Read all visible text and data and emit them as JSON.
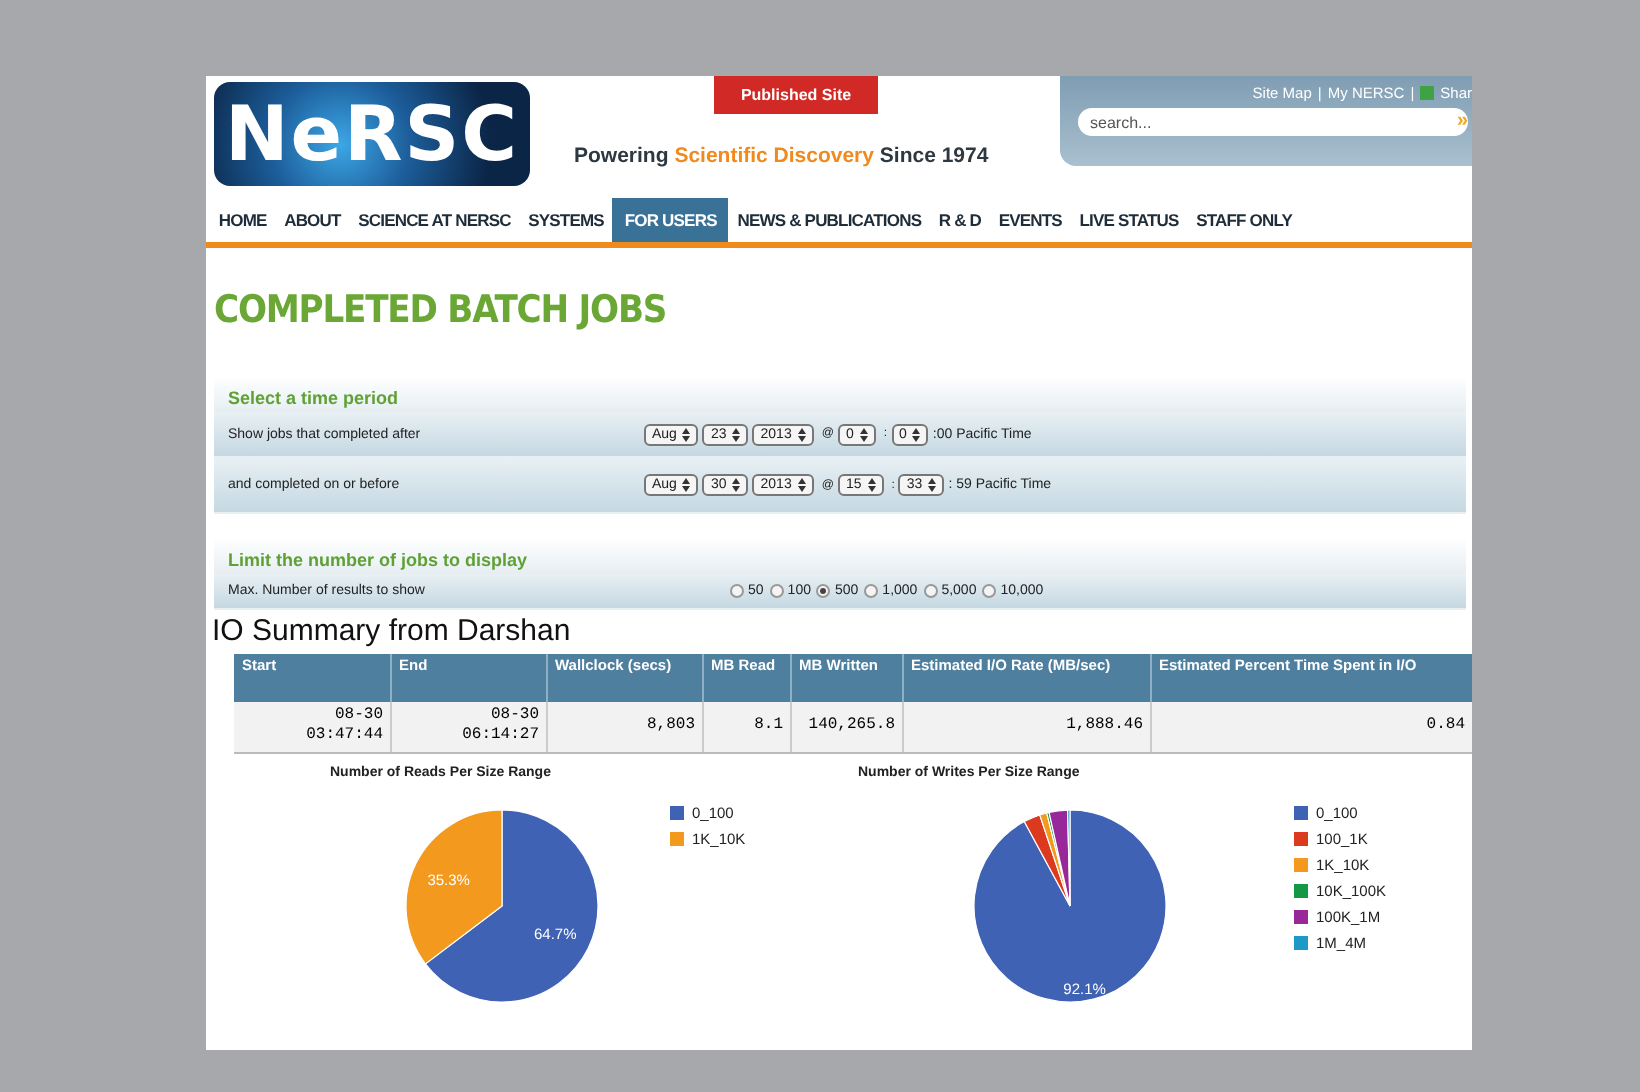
{
  "header": {
    "logo": "NeRSC",
    "published_tab": "Published Site",
    "tagline": {
      "before": "Powering",
      "highlight": "Scientific Discovery",
      "after": "Since 1974"
    },
    "top_links": [
      "Site Map",
      "My NERSC",
      "Shar"
    ],
    "link_separator": "|",
    "search": {
      "placeholder": "search...",
      "button": "»"
    }
  },
  "nav": [
    {
      "label": "HOME",
      "selected": false
    },
    {
      "label": "ABOUT",
      "selected": false
    },
    {
      "label": "SCIENCE AT NERSC",
      "selected": false
    },
    {
      "label": "SYSTEMS",
      "selected": false
    },
    {
      "label": "FOR USERS",
      "selected": true
    },
    {
      "label": "NEWS & PUBLICATIONS",
      "selected": false
    },
    {
      "label": "R & D",
      "selected": false
    },
    {
      "label": "EVENTS",
      "selected": false
    },
    {
      "label": "LIVE STATUS",
      "selected": false
    },
    {
      "label": "STAFF ONLY",
      "selected": false
    }
  ],
  "page_title": "COMPLETED BATCH JOBS",
  "time_period": {
    "heading": "Select a time period",
    "rows": [
      {
        "label": "Show jobs that completed after",
        "month": "Aug",
        "day": "23",
        "year": "2013",
        "at": "@",
        "hour": "0",
        "colon": ":",
        "minute": "0",
        "suffix": ":00 Pacific Time"
      },
      {
        "label": "and completed on or before",
        "month": "Aug",
        "day": "30",
        "year": "2013",
        "at": "@",
        "hour": "15",
        "colon": ":",
        "minute": "33",
        "suffix": ": 59 Pacific Time"
      }
    ]
  },
  "limit": {
    "heading": "Limit the number of jobs to display",
    "label": "Max. Number of results to show",
    "options": [
      {
        "label": "50",
        "selected": false
      },
      {
        "label": "100",
        "selected": false
      },
      {
        "label": "500",
        "selected": true
      },
      {
        "label": "1,000",
        "selected": false
      },
      {
        "label": "5,000",
        "selected": false
      },
      {
        "label": "10,000",
        "selected": false
      }
    ]
  },
  "io_summary": {
    "heading": "IO Summary from Darshan",
    "columns": [
      "Start",
      "End",
      "Wallclock (secs)",
      "MB Read",
      "MB Written",
      "Estimated I/O Rate (MB/sec)",
      "Estimated Percent Time Spent in I/O"
    ],
    "rows": [
      [
        "08-30 03:47:44",
        "08-30 06:14:27",
        "8,803",
        "8.1",
        "140,265.8",
        "1,888.46",
        "0.84"
      ]
    ]
  },
  "charts": [
    {
      "chart_data": {
        "type": "pie",
        "title": "Number of Reads Per Size Range",
        "categories": [
          "0_100",
          "1K_10K"
        ],
        "values": [
          64.7,
          35.3
        ],
        "colors": [
          "#3f62b4",
          "#f39a1e"
        ],
        "value_labels": [
          "64.7%",
          "35.3%"
        ],
        "legend": "right"
      }
    },
    {
      "chart_data": {
        "type": "pie",
        "title": "Number of Writes Per Size Range",
        "categories": [
          "0_100",
          "100_1K",
          "1K_10K",
          "10K_100K",
          "100K_1M",
          "1M_4M"
        ],
        "values": [
          92.1,
          2.8,
          1.2,
          0.4,
          3.1,
          0.4
        ],
        "colors": [
          "#3f62b4",
          "#dc3a1f",
          "#f39a1e",
          "#139846",
          "#98289a",
          "#1c98c9"
        ],
        "value_labels": [
          "92.1%",
          null,
          null,
          null,
          null,
          null
        ],
        "legend": "right"
      }
    }
  ]
}
